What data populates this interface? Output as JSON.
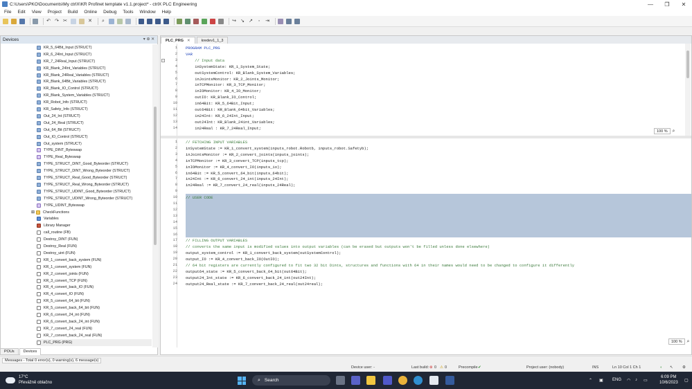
{
  "window": {
    "title": "C:\\Users\\PKO\\Documents\\My ctrlX\\KR Profinet template v1.1.project* - ctrlX PLC Engineering",
    "minimize": "—",
    "maximize": "❐",
    "close": "✕"
  },
  "menu": [
    "File",
    "Edit",
    "View",
    "Project",
    "Build",
    "Online",
    "Debug",
    "Tools",
    "Window",
    "Help"
  ],
  "devices_panel": {
    "title": "Devices",
    "pin": "▾ ⊕ ✕",
    "items": [
      {
        "label": "KR_5_64Bit_Input (STRUCT)",
        "icon": "struct"
      },
      {
        "label": "KR_6_24Int_Input (STRUCT)",
        "icon": "struct"
      },
      {
        "label": "KR_7_24Real_Input (STRUCT)",
        "icon": "struct"
      },
      {
        "label": "KR_Blank_24Int_Variables (STRUCT)",
        "icon": "struct"
      },
      {
        "label": "KR_Blank_24Real_Variables (STRUCT)",
        "icon": "struct"
      },
      {
        "label": "KR_Blank_64Bit_Variables (STRUCT)",
        "icon": "struct"
      },
      {
        "label": "KR_Blank_IO_Control (STRUCT)",
        "icon": "struct"
      },
      {
        "label": "KR_Blank_System_Variables (STRUCT)",
        "icon": "struct"
      },
      {
        "label": "KR_Robot_Info (STRUCT)",
        "icon": "struct"
      },
      {
        "label": "KR_Safety_Info (STRUCT)",
        "icon": "struct"
      },
      {
        "label": "Out_24_Int (STRUCT)",
        "icon": "struct"
      },
      {
        "label": "Out_24_Real (STRUCT)",
        "icon": "struct"
      },
      {
        "label": "Out_64_Bit (STRUCT)",
        "icon": "struct"
      },
      {
        "label": "Out_IO_Control (STRUCT)",
        "icon": "struct"
      },
      {
        "label": "Out_system (STRUCT)",
        "icon": "struct"
      },
      {
        "label": "TYPE_DINT_Byteswap",
        "icon": "dut"
      },
      {
        "label": "TYPE_Real_Byteswap",
        "icon": "dut"
      },
      {
        "label": "TYPE_STRUCT_DINT_Good_Byteorder (STRUCT)",
        "icon": "struct"
      },
      {
        "label": "TYPE_STRUCT_DINT_Wrong_Byteorder (STRUCT)",
        "icon": "struct"
      },
      {
        "label": "TYPE_STRUCT_Real_Good_Byteorder (STRUCT)",
        "icon": "struct"
      },
      {
        "label": "TYPE_STRUCT_Real_Wrong_Byteorder (STRUCT)",
        "icon": "struct"
      },
      {
        "label": "TYPE_STRUCT_UDINT_Good_Byteorder (STRUCT)",
        "icon": "struct"
      },
      {
        "label": "TYPE_STRUCT_UDINT_Wrong_Byteorder (STRUCT)",
        "icon": "struct"
      },
      {
        "label": "TYPE_UDINT_Byteswap",
        "icon": "dut"
      },
      {
        "label": "CheckFunctions",
        "icon": "folder"
      },
      {
        "label": "Variables",
        "icon": "gvl"
      },
      {
        "label": "Library Manager",
        "icon": "lib"
      },
      {
        "label": "call_routine (FB)",
        "icon": "fun"
      },
      {
        "label": "Destroy_DINT (FUN)",
        "icon": "fun"
      },
      {
        "label": "Destroy_Real (FUN)",
        "icon": "fun"
      },
      {
        "label": "Destroy_uint (FUN)",
        "icon": "fun"
      },
      {
        "label": "KR_1_convert_back_system (FUN)",
        "icon": "fun"
      },
      {
        "label": "KR_1_convert_system (FUN)",
        "icon": "fun"
      },
      {
        "label": "KR_2_convert_joints (FUN)",
        "icon": "fun"
      },
      {
        "label": "KR_3_convert_TCP (FUN)",
        "icon": "fun"
      },
      {
        "label": "KR_4_convert_back_IO (FUN)",
        "icon": "fun"
      },
      {
        "label": "KR_4_convert_IO (FUN)",
        "icon": "fun"
      },
      {
        "label": "KR_5_convert_64_bit (FUN)",
        "icon": "fun"
      },
      {
        "label": "KR_5_convert_back_64_bit (FUN)",
        "icon": "fun"
      },
      {
        "label": "KR_6_convert_24_int (FUN)",
        "icon": "fun"
      },
      {
        "label": "KR_6_convert_back_24_int (FUN)",
        "icon": "fun"
      },
      {
        "label": "KR_7_convert_24_real (FUN)",
        "icon": "fun"
      },
      {
        "label": "KR_7_convert_back_24_real (FUN)",
        "icon": "fun"
      },
      {
        "label": "PLC_PRG (PRG)",
        "icon": "fun"
      }
    ],
    "tabs": [
      "POUs",
      "Devices"
    ]
  },
  "editor": {
    "tabs": [
      {
        "label": "PLC_PRG"
      },
      {
        "label": "kredev1_1_3"
      }
    ],
    "declaration": [
      {
        "n": "1",
        "t": "PROGRAM PLC_PRG",
        "k": "k"
      },
      {
        "n": "2",
        "t": "VAR",
        "k": "k"
      },
      {
        "n": "3",
        "t": "    // Input data",
        "k": "c"
      },
      {
        "n": "4",
        "t": "    inSystemState: KR_1_System_State;",
        "k": ""
      },
      {
        "n": "5",
        "t": "    outSystemControl: KR_Blank_System_Variables;",
        "k": ""
      },
      {
        "n": "6",
        "t": "    inJointsMonitor: KR_2_Joints_Monitor;",
        "k": ""
      },
      {
        "n": "7",
        "t": "    inTCPMonitor: KR_3_TCP_Monitor;",
        "k": ""
      },
      {
        "n": "8",
        "t": "    inIOMonitor: KR_4_IO_Monitor;",
        "k": ""
      },
      {
        "n": "9",
        "t": "    outIO: KR_Blank_IO_Control;",
        "k": ""
      },
      {
        "n": "10",
        "t": "    in64Bit: KR_5_64Bit_Input;",
        "k": ""
      },
      {
        "n": "11",
        "t": "    out64Bit: KR_Blank_64bit_Variables;",
        "k": ""
      },
      {
        "n": "12",
        "t": "    in24Int: KR_6_24Int_Input;",
        "k": ""
      },
      {
        "n": "13",
        "t": "    out24Int: KR_Blank_24int_Variables;",
        "k": ""
      },
      {
        "n": "14",
        "t": "    in24Real : KR_7_24Real_Input;",
        "k": ""
      }
    ],
    "implementation": [
      {
        "n": "1",
        "t": "// FETCHING INPUT VARIABLES",
        "k": "c"
      },
      {
        "n": "2",
        "t": "inSystemState := KR_1_convert_system(inputs_robot.Robotb, inputs_robot.Safetyb);",
        "k": ""
      },
      {
        "n": "3",
        "t": "inJointsMonitor := KR_2_convert_joints(inputs_joints);",
        "k": ""
      },
      {
        "n": "4",
        "t": "inTCPMonitor := KR_3_convert_TCP(inputs_tcp);",
        "k": ""
      },
      {
        "n": "5",
        "t": "inIOMonitor := KR_4_convert_IO(inputs_io);",
        "k": ""
      },
      {
        "n": "6",
        "t": "in64Bit := KR_5_convert_64_bit(inputs_64bit);",
        "k": ""
      },
      {
        "n": "7",
        "t": "in24Int := KR_6_convert_24_int(inputs_24Int);",
        "k": ""
      },
      {
        "n": "8",
        "t": "in24Real := KR_7_convert_24_real(inputs_24Real);",
        "k": ""
      },
      {
        "n": "9",
        "t": "",
        "k": ""
      },
      {
        "n": "10",
        "t": "// USER CODE",
        "k": "c"
      },
      {
        "n": "11",
        "t": "",
        "k": ""
      },
      {
        "n": "12",
        "t": "",
        "k": ""
      },
      {
        "n": "13",
        "t": "",
        "k": ""
      },
      {
        "n": "14",
        "t": "",
        "k": ""
      },
      {
        "n": "15",
        "t": "",
        "k": ""
      },
      {
        "n": "16",
        "t": "",
        "k": ""
      },
      {
        "n": "17",
        "t": "// FILLING OUTPUT VARIABLES",
        "k": "c"
      },
      {
        "n": "18",
        "t": "// converts the same input is modified values into output variables (can be erased but outputs won't be filled unless done elsewhere)",
        "k": "c"
      },
      {
        "n": "19",
        "t": "output_system_control := KR_1_convert_back_system(outSystemControl);",
        "k": ""
      },
      {
        "n": "20",
        "t": "output_IO := KR_4_convert_back_IO(OutIO);",
        "k": ""
      },
      {
        "n": "21",
        "t": "// 64 bit registers are currently configured to fit two 32 bit Dints, structures and functions with 64 in their names would need to be changed to configure it differently",
        "k": "c"
      },
      {
        "n": "22",
        "t": "output64_state := KR_5_convert_back_64_bit(out64Bit);",
        "k": ""
      },
      {
        "n": "23",
        "t": "output24_Int_state := KR_6_convert_back_24_int(out24Int);",
        "k": ""
      },
      {
        "n": "24",
        "t": "output24_Real_state := KR_7_convert_back_24_real(out24real);",
        "k": ""
      }
    ],
    "zoom_decl": "100 %",
    "zoom_impl": "100 %"
  },
  "messages": "Messages - Total 0 error(s), 0 warning(s), 6 message(s)",
  "status": {
    "device_user": "Device user: -",
    "last_build": "Last build:",
    "last_build_errors": "0",
    "last_build_warnings": "0",
    "precompile": "Precompile",
    "project_user": "Project user: (nobody)",
    "ins": "INS",
    "position": "Ln 10   Col 1   Ch 1"
  },
  "taskbar": {
    "temperature": "17°C",
    "weather": "Převážně oblačno",
    "search": "Search",
    "lang": "ENG",
    "time": "6:09 PM",
    "date": "10/6/2023"
  },
  "colors": {
    "accent": "#4a7fc1",
    "user_code_highlight": "#b6c6da",
    "comment": "#3a7a3a",
    "keyword": "#1a3fb8",
    "taskbar": "#202735"
  }
}
